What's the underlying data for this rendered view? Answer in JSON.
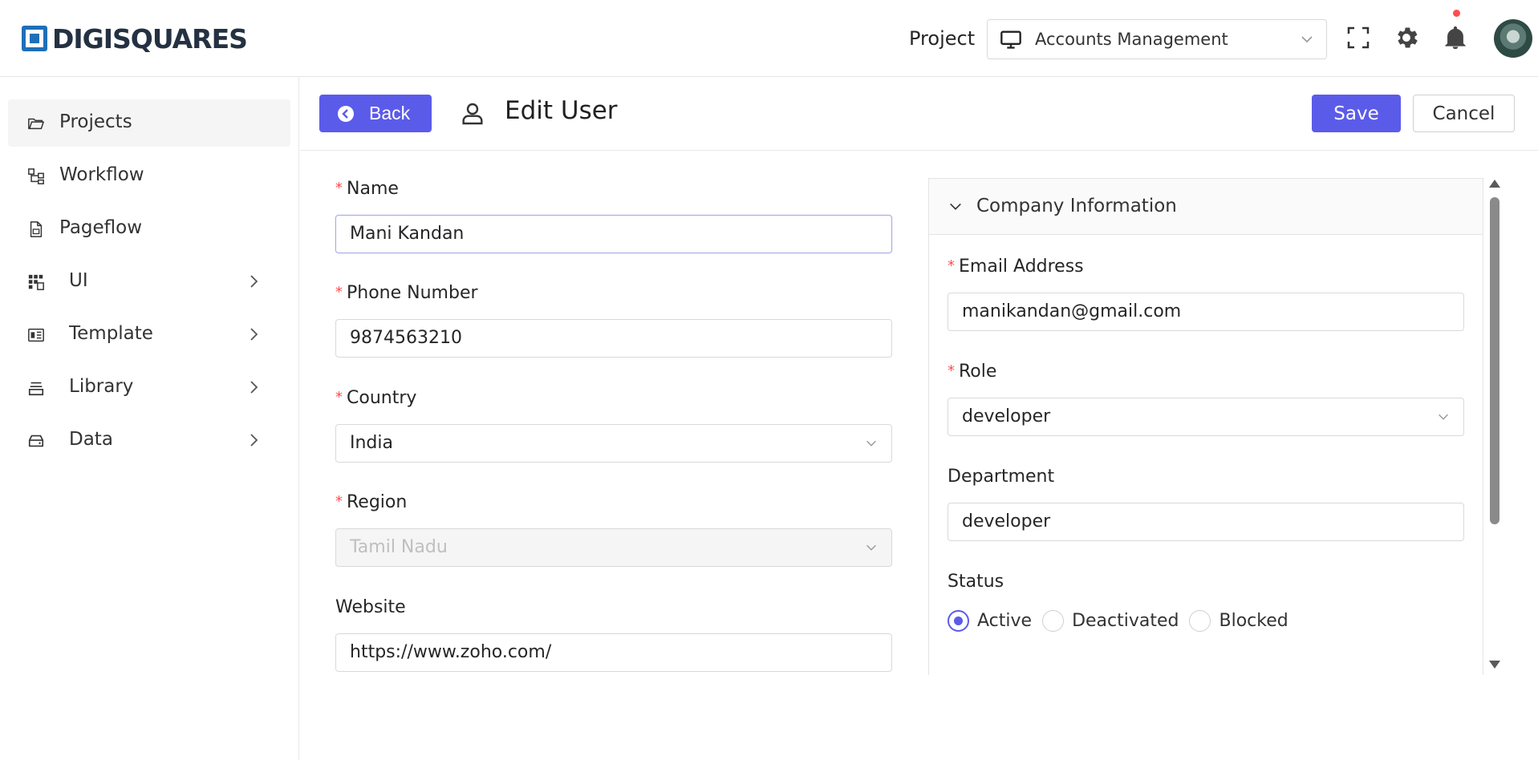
{
  "header": {
    "logo_text": "DIGISQUARES",
    "project_label": "Project",
    "project_value": "Accounts Management",
    "icons": [
      "fullscreen-icon",
      "gear-icon",
      "bell-icon"
    ]
  },
  "sidebar": {
    "items": [
      {
        "label": "Projects",
        "icon": "folder-open-icon",
        "expandable": false
      },
      {
        "label": "Workflow",
        "icon": "workflow-icon",
        "expandable": false
      },
      {
        "label": "Pageflow",
        "icon": "file-icon",
        "expandable": false
      },
      {
        "label": "UI",
        "icon": "grid-icon",
        "expandable": true
      },
      {
        "label": "Template",
        "icon": "template-icon",
        "expandable": true
      },
      {
        "label": "Library",
        "icon": "library-icon",
        "expandable": true
      },
      {
        "label": "Data",
        "icon": "drive-icon",
        "expandable": true
      }
    ]
  },
  "toolbar": {
    "back_label": "Back",
    "title": "Edit User",
    "save_label": "Save",
    "cancel_label": "Cancel"
  },
  "form": {
    "name": {
      "label": "Name",
      "value": "Mani Kandan"
    },
    "phone": {
      "label": "Phone Number",
      "value": "9874563210"
    },
    "country": {
      "label": "Country",
      "value": "India"
    },
    "region": {
      "label": "Region",
      "value": "Tamil Nadu"
    },
    "website": {
      "label": "Website",
      "value": "https://www.zoho.com/"
    }
  },
  "company": {
    "title": "Company Information",
    "email": {
      "label": "Email Address",
      "value": "manikandan@gmail.com"
    },
    "role": {
      "label": "Role",
      "value": "developer"
    },
    "department": {
      "label": "Department",
      "value": "developer"
    },
    "status": {
      "label": "Status",
      "options": [
        "Active",
        "Deactivated",
        "Blocked"
      ],
      "selected": "Active"
    }
  },
  "colors": {
    "accent": "#5b5bea",
    "required": "#ff4d4f",
    "brand": "#1e6fb8"
  }
}
